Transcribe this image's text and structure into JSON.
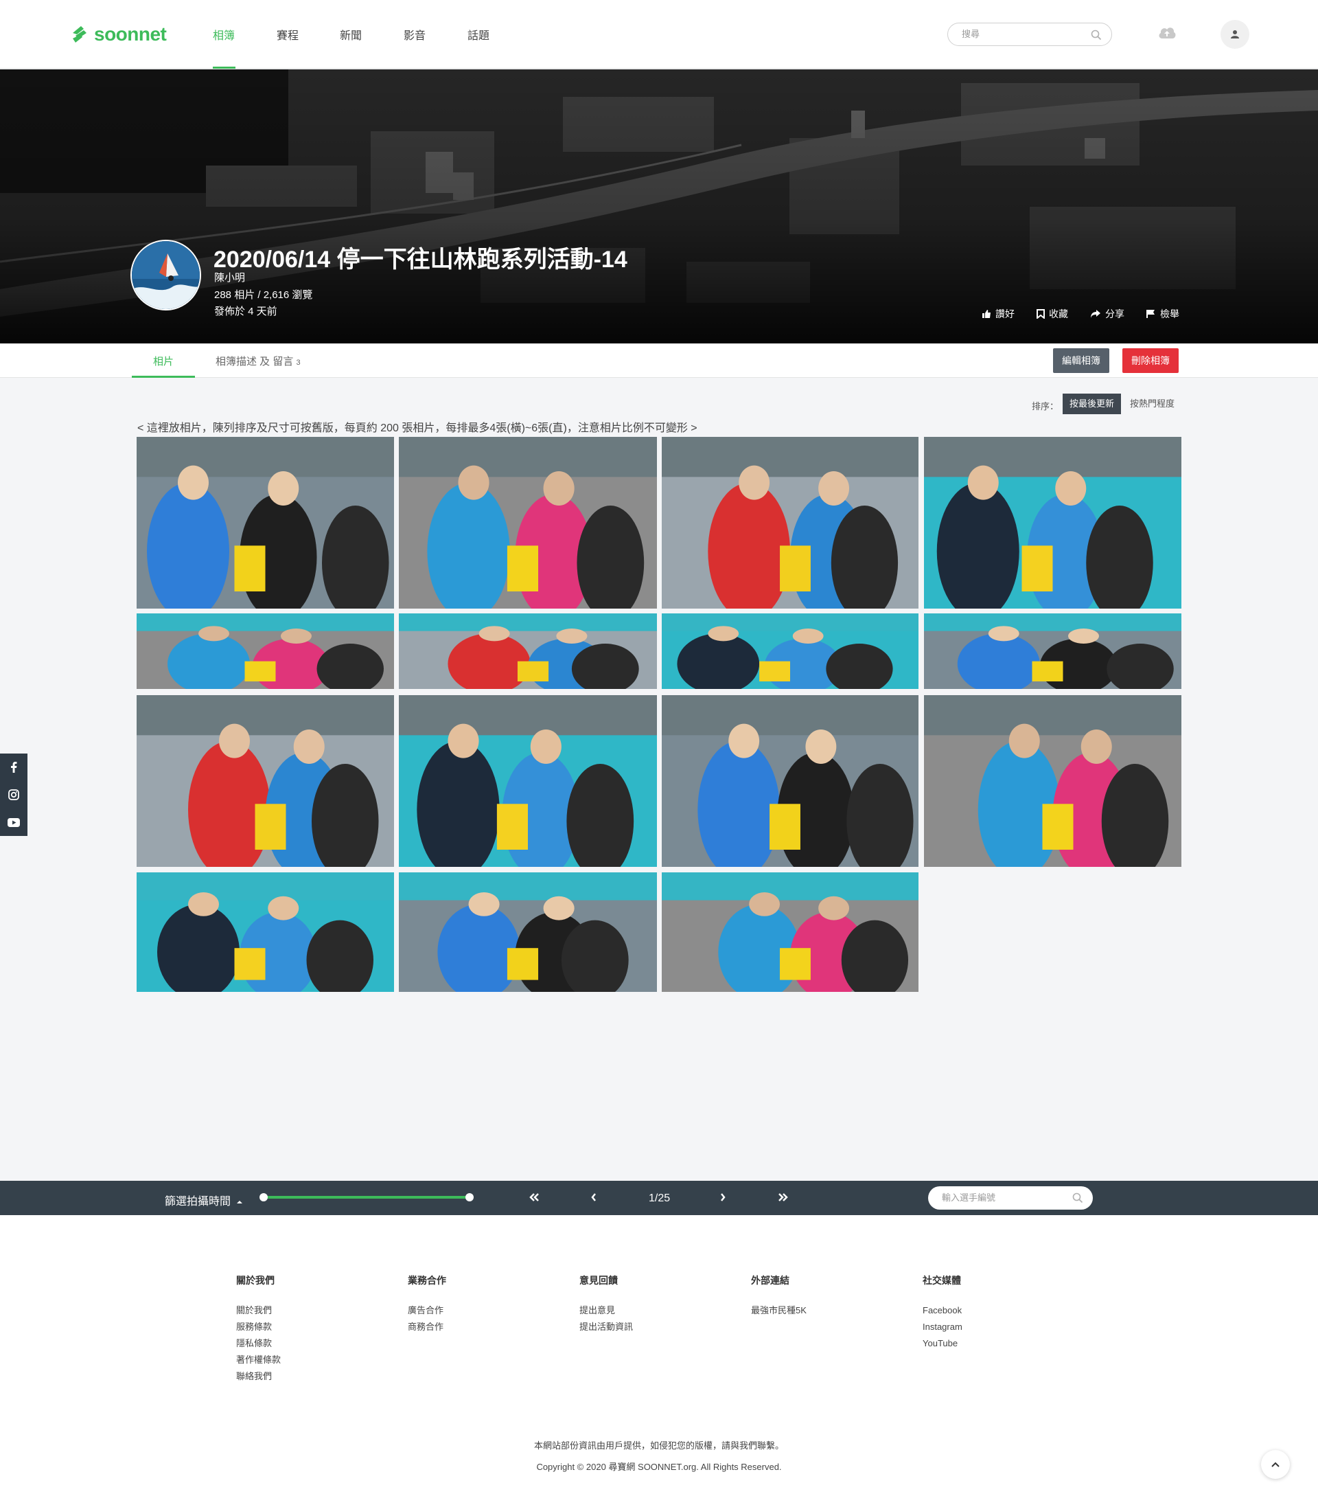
{
  "brand": {
    "name": "soonnet",
    "accent": "#3dbb5a"
  },
  "nav": {
    "items": [
      {
        "label": "相簿",
        "active": true
      },
      {
        "label": "賽程"
      },
      {
        "label": "新聞"
      },
      {
        "label": "影音"
      },
      {
        "label": "話題"
      }
    ],
    "search_placeholder": "搜尋"
  },
  "album": {
    "title": "2020/06/14 停一下往山林跑系列活動-14",
    "author": "陳小明",
    "stats": "288 相片 / 2,616 瀏覽",
    "published": "發佈於 4 天前",
    "actions": [
      {
        "label": "讚好",
        "icon": "thumbs-up-icon"
      },
      {
        "label": "收藏",
        "icon": "bookmark-icon"
      },
      {
        "label": "分享",
        "icon": "share-icon"
      },
      {
        "label": "檢舉",
        "icon": "flag-icon"
      }
    ]
  },
  "tabs": [
    {
      "label": "相片",
      "active": true
    },
    {
      "label": "相簿描述 及 留言",
      "count": "3"
    }
  ],
  "buttons": {
    "edit": "編輯相簿",
    "delete": "刪除相簿"
  },
  "sort": {
    "label": "排序：",
    "options": [
      "按最後更新",
      "按熱門程度"
    ],
    "active": "按最後更新"
  },
  "notice": "< 這裡放相片，陳列排序及尺寸可按舊版，每頁約 200 張相片，每排最多4張(橫)~6張(直)，注意相片比例不可變形 >",
  "photos": {
    "count": 15,
    "rows": [
      4,
      4,
      4,
      3
    ]
  },
  "side_social": [
    "facebook-icon",
    "instagram-icon",
    "youtube-icon"
  ],
  "filterbar": {
    "label": "篩選拍攝時間",
    "page": "1/25",
    "runner_placeholder": "輸入選手編號"
  },
  "footer": {
    "columns": [
      {
        "title": "關於我們",
        "links": [
          "關於我們",
          "服務條款",
          "隱私條款",
          "著作權條款",
          "聯絡我們"
        ]
      },
      {
        "title": "業務合作",
        "links": [
          "廣告合作",
          "商務合作"
        ]
      },
      {
        "title": "意見回饋",
        "links": [
          "提出意見",
          "提出活動資訊"
        ]
      },
      {
        "title": "外部連結",
        "links": [
          "最強市民種5K"
        ]
      },
      {
        "title": "社交媒體",
        "links": [
          "Facebook",
          "Instagram",
          "YouTube"
        ]
      }
    ],
    "notice": "本網站部份資訊由用戶提供，如侵犯您的版權，請與我們聯繫。",
    "copyright": "Copyright © 2020 尋寶網 SOONNET.org. All Rights Reserved."
  }
}
